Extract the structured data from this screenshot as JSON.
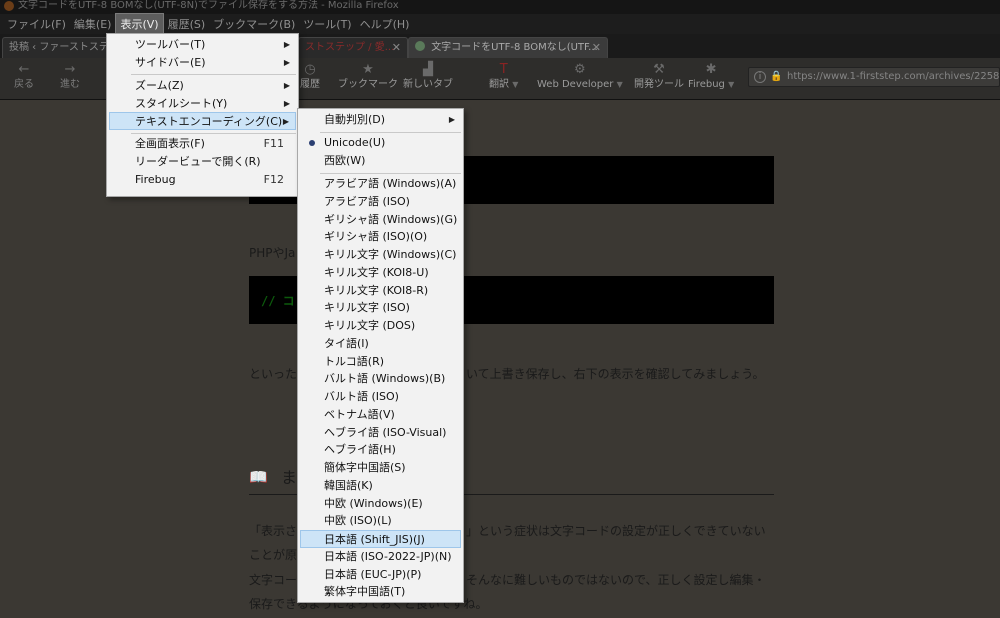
{
  "window": {
    "title": "文字コードをUTF-8 BOMなし(UTF-8N)でファイル保存をする方法 - Mozilla Firefox"
  },
  "menubar": [
    "ファイル(F)",
    "編集(E)",
    "表示(V)",
    "履歴(S)",
    "ブックマーク(B)",
    "ツール(T)",
    "ヘルプ(H)"
  ],
  "tabs": [
    {
      "label": "投稿 ‹ ファーストステ"
    },
    {
      "label": "ストステップ / 愛..."
    },
    {
      "label": "文字コードをUTF-8 BOMなし(UTF..."
    }
  ],
  "toolbar": {
    "back": "戻る",
    "forward": "進む",
    "history": "履歴",
    "bookmarks": "ブックマーク",
    "new_tab": "新しいタブ",
    "translate": "翻訳",
    "web_developer": "Web Developer",
    "dev_tools": "開発ツール",
    "firebug": "Firebug",
    "url": "https://www.1-firststep.com/archives/2258"
  },
  "page": {
    "p1": "PHPやJa",
    "code": "// コ",
    "p2a": "といった",
    "p2b": "いて上書き保存し、右下の表示を確認してみましょう。",
    "heading": "ま",
    "p3a": "「表示さ",
    "p3b": "」という症状は文字コードの設定が正しくできていない",
    "p3c": "ことが原",
    "p4a": "文字コー",
    "p4b": "そんなに難しいものではないので、正しく設定し編集・",
    "p4c": "保存できるようになっておくと良いですね。"
  },
  "view_menu": {
    "items": [
      {
        "label": "ツールバー(T)",
        "submenu": "▶"
      },
      {
        "label": "サイドバー(E)",
        "submenu": "▶"
      },
      {
        "label": "ズーム(Z)",
        "submenu": "▶"
      },
      {
        "label": "スタイルシート(Y)",
        "submenu": "▶"
      },
      {
        "label": "テキストエンコーディング(C)",
        "submenu": "▶"
      },
      {
        "label": "全画面表示(F)",
        "shortcut": "F11"
      },
      {
        "label": "リーダービューで開く(R)"
      },
      {
        "label": "Firebug",
        "shortcut": "F12"
      }
    ]
  },
  "encoding_menu": {
    "auto_detect": "自動判別(D)",
    "auto_arrow": "▶",
    "unicode": "Unicode(U)",
    "western": "西欧(W)",
    "items": [
      "アラビア語 (Windows)(A)",
      "アラビア語 (ISO)",
      "ギリシャ語 (Windows)(G)",
      "ギリシャ語 (ISO)(O)",
      "キリル文字 (Windows)(C)",
      "キリル文字 (KOI8-U)",
      "キリル文字 (KOI8-R)",
      "キリル文字 (ISO)",
      "キリル文字 (DOS)",
      "タイ語(I)",
      "トルコ語(R)",
      "バルト語 (Windows)(B)",
      "バルト語 (ISO)",
      "ベトナム語(V)",
      "ヘブライ語 (ISO-Visual)",
      "ヘブライ語(H)",
      "簡体字中国語(S)",
      "韓国語(K)",
      "中欧 (Windows)(E)",
      "中欧 (ISO)(L)",
      "日本語 (Shift_JIS)(J)",
      "日本語 (ISO-2022-JP)(N)",
      "日本語 (EUC-JP)(P)",
      "繁体字中国語(T)"
    ],
    "selected_encoding": "Unicode(U)",
    "hovered_item": "日本語 (Shift_JIS)(J)"
  },
  "colors": {
    "highlight": "#cde4f7",
    "menu_bg": "#f2f2f2",
    "radio": "#2b3f72"
  }
}
